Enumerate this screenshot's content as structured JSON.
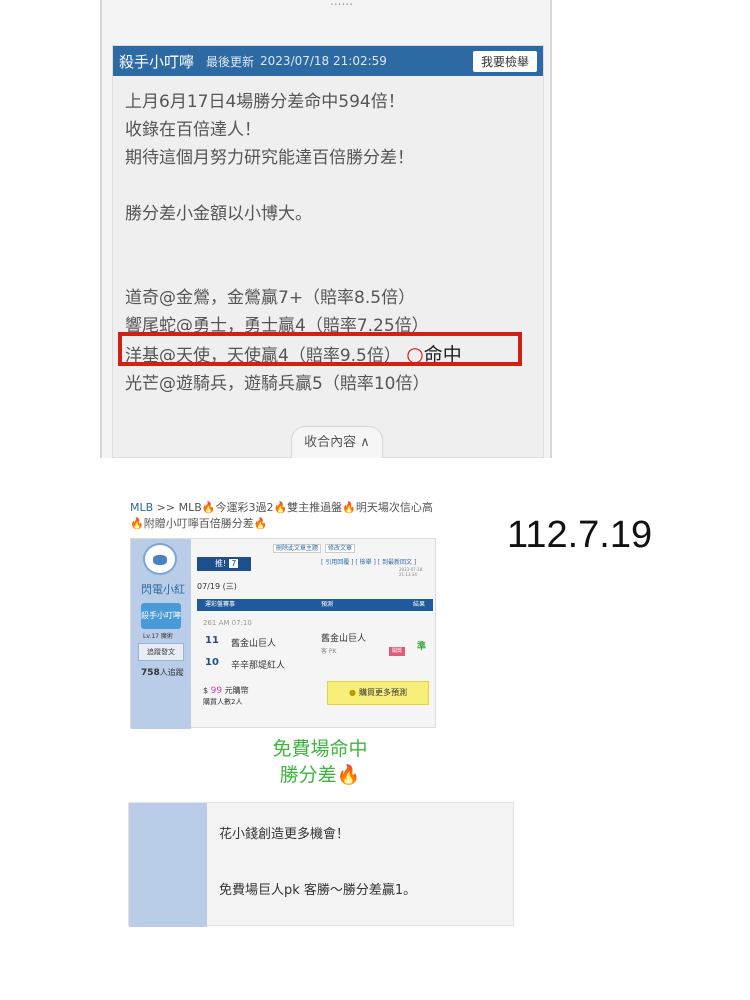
{
  "post": {
    "author": "殺手小叮嚀",
    "updated_label": "最後更新",
    "timestamp": "2023/07/18 21:02:59",
    "report_label": "我要檢舉",
    "lines": [
      "上月6月17日4場勝分差命中594倍！",
      "收錄在百倍達人！",
      "期待這個月努力研究能達百倍勝分差！",
      "勝分差小金額以小博大。",
      "道奇@金鶯，金鶯贏7+（賠率8.5倍）",
      "響尾蛇@勇士，勇士贏4（賠率7.25倍）",
      "洋基@天使，天使贏4（賠率9.5倍）",
      "光芒@遊騎兵，遊騎兵贏5（賠率10倍）"
    ],
    "hit_label": "命中",
    "collapse_label": "收合內容 ∧"
  },
  "thread": {
    "breadcrumb": "MLB",
    "sep": ">>",
    "title": "MLB🔥今運彩3過2🔥雙主推過盤🔥明天場次信心高🔥附贈小叮嚀百倍勝分差🔥",
    "user_name": "閃電小紅",
    "badge": "殺手小叮嚀",
    "level": "Lv.17 魔術",
    "follow_label": "追蹤發文",
    "followers_num": "758",
    "followers_label": "人追蹤",
    "top_links": [
      "刪除此文章主題",
      "修改文章"
    ],
    "push_label": "推!",
    "push_num": "7",
    "quote_links": "[ 引用回覆 ] [ 檢舉 ] [ 到最新回文 ]",
    "mini_ts": "2023-07-18 21:13:34",
    "date": "07/19 (三)",
    "col_match": "運彩盤賽事",
    "col_pred": "預測",
    "col_result": "結果",
    "game_time": "261 AM 07:10",
    "team1_num": "11",
    "team1_name": "舊金山巨人",
    "team2_num": "10",
    "team2_name": "辛辛那堤紅人",
    "pred_team": "舊金山巨人",
    "pred_sub": "客 PK",
    "pred_tag": "開獎",
    "result": "準",
    "price_prefix": "$",
    "price_amt": "99",
    "price_unit": "元購幣",
    "buyers": "購買人數2人",
    "buy_label": "購買更多預測"
  },
  "date_big": "112.7.19",
  "free_hit": {
    "line1": "免費場命中",
    "line2": "勝分差",
    "fire": "🔥"
  },
  "comment": {
    "line1": "花小錢創造更多機會！",
    "line2": "免費場巨人pk 客勝～勝分差贏1。"
  }
}
